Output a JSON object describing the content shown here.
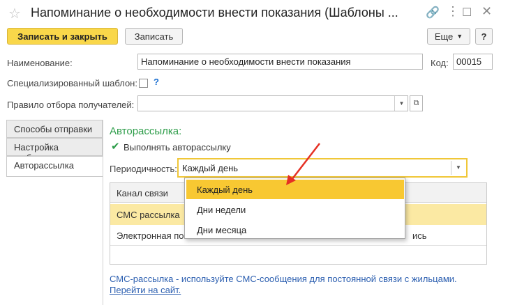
{
  "window": {
    "title": "Напоминание о необходимости внести показания (Шаблоны ..."
  },
  "toolbar": {
    "write_close_label": "Записать и закрыть",
    "write_label": "Записать",
    "more_label": "Еще",
    "help_label": "?"
  },
  "form": {
    "name_label": "Наименование:",
    "name_value": "Напоминание о необходимости внести показания",
    "code_label": "Код:",
    "code_value": "00015",
    "specialized_label": "Специализированный шаблон:",
    "specialized_help": "?",
    "rule_label": "Правило отбора получателей:",
    "rule_value": ""
  },
  "tabs": [
    {
      "label": "Способы отправки"
    },
    {
      "label": "Настройка шаблона"
    },
    {
      "label": "Авторассылка"
    }
  ],
  "auto": {
    "section_title": "Авторассылка:",
    "enable_label": "Выполнять авторассылку",
    "enable_checked": true,
    "period_label": "Периодичность:",
    "period_value": "Каждый день"
  },
  "grid": {
    "header_channel": "Канал связи",
    "rows": [
      {
        "channel": "СМС рассылка",
        "tail": ""
      },
      {
        "channel": "Электронная по",
        "tail": "ись"
      }
    ]
  },
  "dropdown": {
    "options": [
      "Каждый день",
      "Дни недели",
      "Дни месяца"
    ],
    "selected_index": 0
  },
  "footer": {
    "text": "СМС-рассылка - используйте СМС-сообщения для постоянной связи с жильцами.",
    "link": "Перейти на сайт."
  },
  "colors": {
    "accent_yellow": "#f9d74a",
    "selection": "#f8c832",
    "green": "#2e9d4a",
    "link": "#2c5fb0",
    "arrow": "#e53024"
  }
}
